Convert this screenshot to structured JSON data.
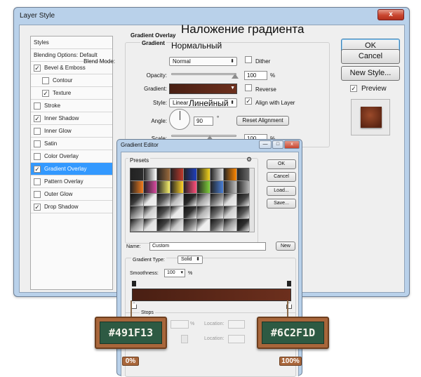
{
  "window": {
    "title": "Layer Style",
    "close_glyph": "x"
  },
  "annotations": {
    "gradient_overlay_ru": "Наложение градиента",
    "normal_ru": "Нормальный",
    "linear_ru": "Линейный"
  },
  "styles_list": [
    {
      "label": "Styles",
      "checkbox": false,
      "checked": false,
      "selected": false,
      "indent": 0
    },
    {
      "label": "Blending Options: Default",
      "checkbox": false,
      "checked": false,
      "selected": false,
      "indent": 0
    },
    {
      "label": "Bevel & Emboss",
      "checkbox": true,
      "checked": true,
      "selected": false,
      "indent": 0
    },
    {
      "label": "Contour",
      "checkbox": true,
      "checked": false,
      "selected": false,
      "indent": 1
    },
    {
      "label": "Texture",
      "checkbox": true,
      "checked": true,
      "selected": false,
      "indent": 1
    },
    {
      "label": "Stroke",
      "checkbox": true,
      "checked": false,
      "selected": false,
      "indent": 0
    },
    {
      "label": "Inner Shadow",
      "checkbox": true,
      "checked": true,
      "selected": false,
      "indent": 0
    },
    {
      "label": "Inner Glow",
      "checkbox": true,
      "checked": false,
      "selected": false,
      "indent": 0
    },
    {
      "label": "Satin",
      "checkbox": true,
      "checked": false,
      "selected": false,
      "indent": 0
    },
    {
      "label": "Color Overlay",
      "checkbox": true,
      "checked": false,
      "selected": false,
      "indent": 0
    },
    {
      "label": "Gradient Overlay",
      "checkbox": true,
      "checked": true,
      "selected": true,
      "indent": 0
    },
    {
      "label": "Pattern Overlay",
      "checkbox": true,
      "checked": false,
      "selected": false,
      "indent": 0
    },
    {
      "label": "Outer Glow",
      "checkbox": true,
      "checked": false,
      "selected": false,
      "indent": 0
    },
    {
      "label": "Drop Shadow",
      "checkbox": true,
      "checked": true,
      "selected": false,
      "indent": 0
    }
  ],
  "gradient_overlay": {
    "legend": "Gradient Overlay",
    "sublegend": "Gradient",
    "blend_mode_label": "Blend Mode:",
    "blend_mode_value": "Normal",
    "dither_label": "Dither",
    "opacity_label": "Opacity:",
    "opacity_value": "100",
    "opacity_unit": "%",
    "gradient_label": "Gradient:",
    "reverse_label": "Reverse",
    "style_label": "Style:",
    "style_value": "Linear",
    "align_label": "Align with Layer",
    "angle_label": "Angle:",
    "angle_value": "90",
    "angle_unit": "°",
    "reset_alignment_label": "Reset Alignment",
    "scale_label": "Scale:",
    "scale_value": "100",
    "scale_unit": "%"
  },
  "right_panel": {
    "ok": "OK",
    "cancel": "Cancel",
    "new_style": "New Style...",
    "preview_label": "Preview"
  },
  "gradient_editor": {
    "title": "Gradient Editor",
    "win_buttons": [
      "—",
      "□",
      "x"
    ],
    "presets_label": "Presets",
    "gear_glyph": "⚙",
    "buttons": {
      "ok": "OK",
      "cancel": "Cancel",
      "load": "Load...",
      "save": "Save..."
    },
    "name_label": "Name:",
    "name_value": "Custom",
    "new_button": "New",
    "gradient_type_label": "Gradient Type:",
    "gradient_type_value": "Solid",
    "smoothness_label": "Smoothness:",
    "smoothness_value": "100",
    "smoothness_unit": "%",
    "stops_label": "Stops",
    "location_label": "Location:",
    "percent_sign": "%"
  },
  "color_stops": [
    {
      "hex_label": "#491F13",
      "position_label": "0%",
      "color": "#491f13"
    },
    {
      "hex_label": "#6C2F1D",
      "position_label": "100%",
      "color": "#6c2f1d"
    }
  ],
  "preset_swatches": [
    "#2c2c2c",
    "#ffffff",
    "#9c6b3c",
    "#c0392b",
    "#1f3fbf",
    "#f2d31b",
    "#e0e0e0",
    "#ff8800",
    "#6d6d6d",
    "#f27c1d",
    "#d94aa0",
    "#f6f06a",
    "#ffd42a",
    "#ff4f7a",
    "#7fd03a",
    "#4a7fd4",
    "#c0c0c0",
    "#bbbbbb",
    "#3a3a3a",
    "#e8e8e8",
    "#5b5b5b",
    "#bfbfbf",
    "#2a2a2a",
    "#a8a8a8",
    "#7a7a7a",
    "#dcdcdc",
    "#444444",
    "#8a8a8a",
    "#cfcfcf",
    "#4d4d4d",
    "#eaeaea",
    "#333333",
    "#b5b5b5",
    "#6a6a6a",
    "#d0d0d0",
    "#555555",
    "#9a9a9a",
    "#e2e2e2",
    "#3f3f3f",
    "#c8c8c8",
    "#707070",
    "#f0f0f0",
    "#5a5a5a",
    "#a0a0a0",
    "#2f2f2f"
  ]
}
